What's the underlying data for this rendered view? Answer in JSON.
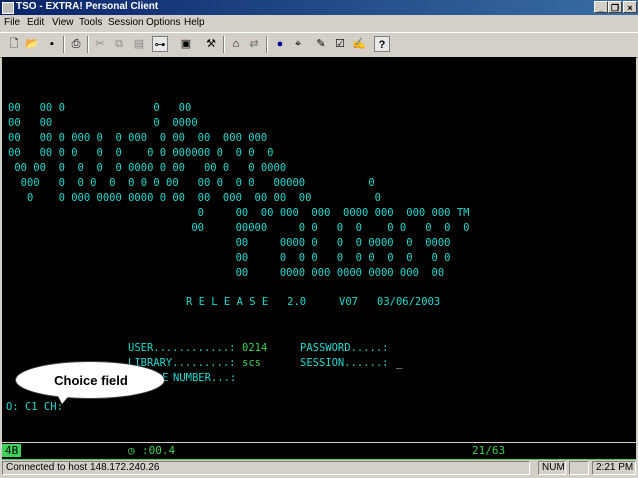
{
  "window": {
    "title": "TSO - EXTRA! Personal Client"
  },
  "menu": [
    "File",
    "Edit",
    "View",
    "Tools",
    "Session",
    "Options",
    "Help"
  ],
  "toolbar_icons": [
    "new-document-icon",
    "open-folder-icon",
    "save-icon",
    "print-icon",
    "cut-icon",
    "copy-icon",
    "paste-icon",
    "connect-icon",
    "open-session-icon",
    "tools-icon",
    "macro-icon",
    "transfer-icon",
    "dot-icon",
    "mouse-icon",
    "edit-icon",
    "check-icon",
    "signature-icon",
    "help-icon"
  ],
  "screen": {
    "logo_lines": [
      "00   00 0              0   00",
      "00   00                0  0000",
      "00   00 0 000 0  0 000  0 00  00  000 000",
      "00   00 0 0   0  0    0 0 000000 0  0 0  0",
      " 00 00  0  0  0  0 0000 0 00   00 0   0 0000",
      "  000   0  0 0  0  0 0 0 00   00 0  0 0   00000          0",
      "   0    0 000 0000 0000 0 00  00  000  00 00  00          0",
      "                              0     00  00 000  000  0000 000  000 000 TM",
      "                             00     00000     0 0   0  0    0 0   0  0  0",
      "                                    00     0000 0   0  0 0000  0  0000",
      "                                    00     0  0 0   0  0 0  0  0   0 0",
      "                                    00     0000 000 0000 0000 000  00"
    ],
    "release_label": "R E L E A S E   2.0",
    "version": "V07",
    "date": "03/06/2003",
    "user_label": "USER............:",
    "user_value": "0214",
    "password_label": "PASSWORD.....:",
    "library_label": "LIBRARY.........:",
    "library_value": "scs",
    "session_label": "SESSION......:",
    "session_value": "_",
    "number_label": "NUMBER...:",
    "number_partial_prefix": "E",
    "command_line": "O: C1 CH:"
  },
  "callout": {
    "text": "Choice field"
  },
  "oia": {
    "indicator": "4B",
    "clock_icon": "clock-icon",
    "time": ":00.4",
    "cursor_pos": "21/63"
  },
  "statusbar": {
    "connection": "Connected to host 148.172.240.26",
    "num": "NUM",
    "clock": "2:21 PM"
  }
}
